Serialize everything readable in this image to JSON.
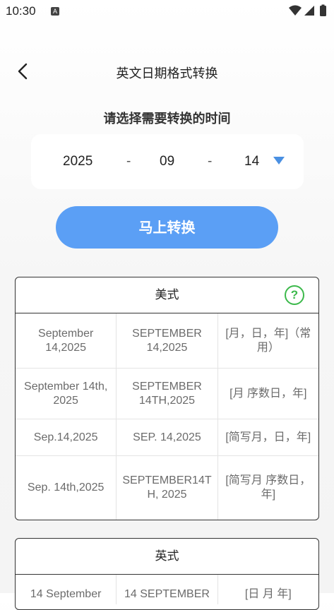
{
  "status_bar": {
    "time": "10:30",
    "notification_icon": "A"
  },
  "header": {
    "title": "英文日期格式转换"
  },
  "picker": {
    "prompt": "请选择需要转换的时间",
    "year": "2025",
    "month": "09",
    "day": "14",
    "separator": "-"
  },
  "convert_button": {
    "label": "马上转换"
  },
  "cards": [
    {
      "title": "美式",
      "rows": [
        [
          "September 14,2025",
          "SEPTEMBER 14,2025",
          "[月，日，年]（常用）"
        ],
        [
          "September 14th, 2025",
          "SEPTEMBER 14TH,2025",
          "[月 序数日，年]"
        ],
        [
          "Sep.14,2025",
          "SEP. 14,2025",
          "[简写月，日，年]"
        ],
        [
          "Sep. 14th,2025",
          "SEPTEMBER14TH, 2025",
          "[简写月 序数日，年]"
        ]
      ]
    },
    {
      "title": "英式",
      "rows": [
        [
          "14 September",
          "14 SEPTEMBER",
          "[日 月 年]"
        ]
      ]
    }
  ],
  "colors": {
    "accent": "#5b9ff5",
    "help": "#3cb94b",
    "dropdown": "#4a90e2"
  }
}
